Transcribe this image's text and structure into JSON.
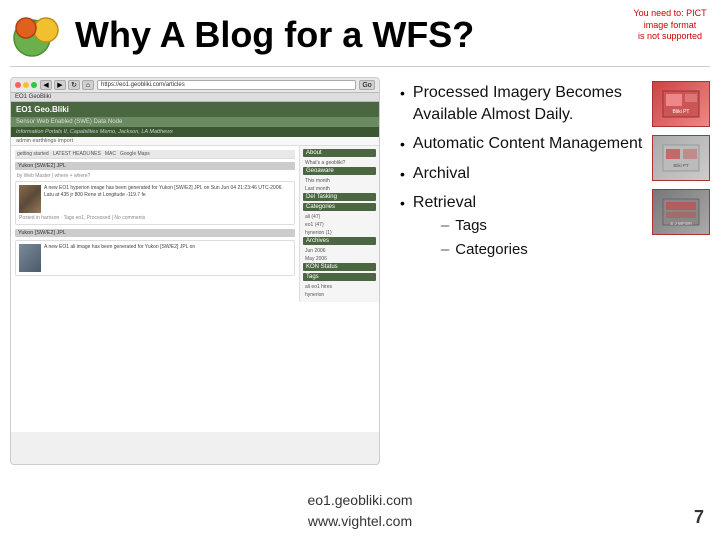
{
  "header": {
    "title": "Why A Blog for a WFS?",
    "pict_notice_line1": "You need to: PICT",
    "pict_notice_line2": "image format",
    "pict_notice_line3": "is not supported"
  },
  "browser": {
    "url": "https://eo1.geobliki.com/articles",
    "site_title": "EO1 Geo.Bliki",
    "site_subtitle": "Sensor Web Enabled (SWE) Data Node",
    "site_description": "Information Portals II, Capabilities Memo, Jackson, LA Matthews",
    "site_tagline": "admin earthlings import",
    "nav_about": "About",
    "nav_what": "What's a geobliki?",
    "nav_geoaware": "Geoaware",
    "nav_del": "Del Tasking",
    "nav_categories": "Categories",
    "nav_archives": "Archives",
    "nav_kon_status": "KON Status",
    "nav_tags": "Tags",
    "tag_ali": "ali",
    "tag_eo1": "eo1",
    "tag_hires": "hires",
    "tag_hynerion": "hynerion",
    "post1_title": "Yukon [SW/E2] JPL",
    "post1_meta": "Web Master",
    "post2_title": "Yukon [SW/E2] JPL",
    "post1_body": "A new EO1 hyperion image has been generated for Yukon [SW/E2] JPL on Sun Jun 04 21:23:46 UTC-2006. Latu at 435 jr 800 Rene st Longitude -119.7 fe",
    "post2_body": "A new EO1 ali image has been generated for Yukon [SW/E2] JPL on"
  },
  "bullets": [
    {
      "text": "Processed Imagery Becomes Available Almost Daily."
    },
    {
      "text": "Automatic Content Management"
    },
    {
      "text": "Archival"
    },
    {
      "text": "Retrieval",
      "sub": [
        "Tags",
        "Categories"
      ]
    }
  ],
  "footer": {
    "line1": "eo1.geobliki.com",
    "line2": "www.vightel.com",
    "page_number": "7"
  }
}
